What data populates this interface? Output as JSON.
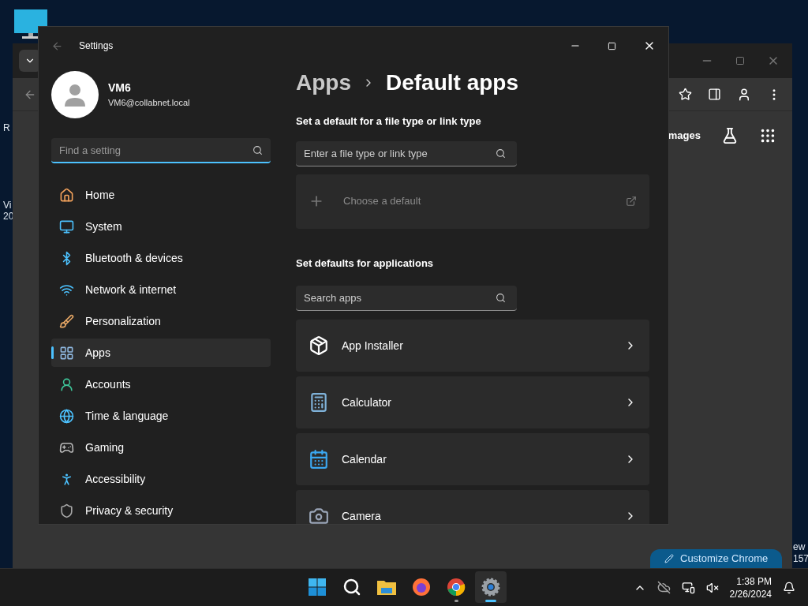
{
  "desktop": {
    "left_labels": [
      [
        "R"
      ],
      [
        "Vi",
        "20"
      ]
    ],
    "right_labels": [
      "ew",
      "157"
    ]
  },
  "browser": {
    "tab_text": "mages",
    "customize_button": "Customize Chrome"
  },
  "settings": {
    "title": "Settings",
    "user": {
      "name": "VM6",
      "email": "VM6@collabnet.local"
    },
    "search": {
      "placeholder": "Find a setting"
    },
    "nav": [
      {
        "label": "Home",
        "selected": false
      },
      {
        "label": "System",
        "selected": false
      },
      {
        "label": "Bluetooth & devices",
        "selected": false
      },
      {
        "label": "Network & internet",
        "selected": false
      },
      {
        "label": "Personalization",
        "selected": false
      },
      {
        "label": "Apps",
        "selected": true
      },
      {
        "label": "Accounts",
        "selected": false
      },
      {
        "label": "Time & language",
        "selected": false
      },
      {
        "label": "Gaming",
        "selected": false
      },
      {
        "label": "Accessibility",
        "selected": false
      },
      {
        "label": "Privacy & security",
        "selected": false
      }
    ],
    "breadcrumb": [
      "Apps",
      "Default apps"
    ],
    "file_type_section": {
      "heading": "Set a default for a file type or link type",
      "placeholder": "Enter a file type or link type",
      "choose_default": "Choose a default"
    },
    "apps_section": {
      "heading": "Set defaults for applications",
      "placeholder": "Search apps",
      "apps": [
        {
          "name": "App Installer"
        },
        {
          "name": "Calculator"
        },
        {
          "name": "Calendar"
        },
        {
          "name": "Camera"
        }
      ]
    }
  },
  "taskbar": {
    "apps": [
      {
        "kind": "start",
        "selected": false,
        "running": false
      },
      {
        "kind": "search",
        "selected": false,
        "running": false
      },
      {
        "kind": "files",
        "selected": false,
        "running": false
      },
      {
        "kind": "firefox",
        "selected": false,
        "running": false
      },
      {
        "kind": "chrome",
        "selected": false,
        "running": true
      },
      {
        "kind": "settings",
        "selected": true,
        "running": true
      }
    ],
    "time": "1:38 PM",
    "date": "2/26/2024"
  }
}
